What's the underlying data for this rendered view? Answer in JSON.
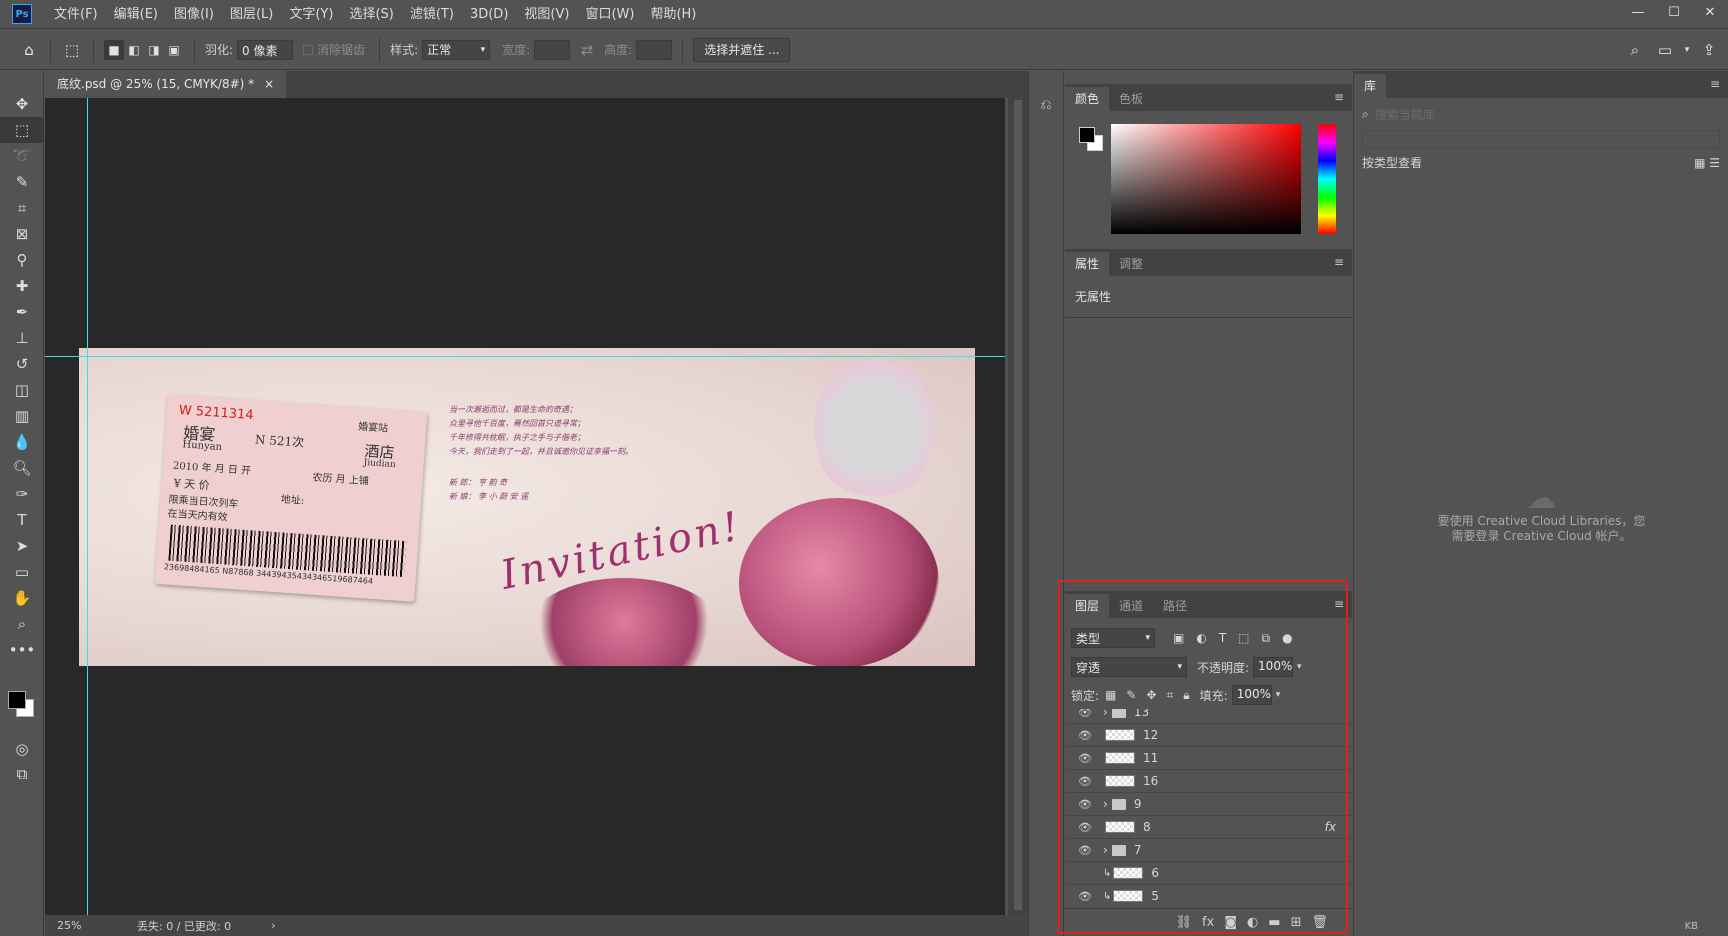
{
  "app": {
    "logo": "Ps"
  },
  "menu": [
    "文件(F)",
    "编辑(E)",
    "图像(I)",
    "图层(L)",
    "文字(Y)",
    "选择(S)",
    "滤镜(T)",
    "3D(D)",
    "视图(V)",
    "窗口(W)",
    "帮助(H)"
  ],
  "window_controls": {
    "minimize": "—",
    "maximize": "☐",
    "close": "✕"
  },
  "options": {
    "feather_label": "羽化:",
    "feather_value": "0 像素",
    "antialias_label": "消除锯齿",
    "style_label": "样式:",
    "style_value": "正常",
    "width_label": "宽度:",
    "height_label": "高度:",
    "select_mask_button": "选择并遮住 ..."
  },
  "document": {
    "tab_title": "底纹.psd @ 25% (15, CMYK/8#) *",
    "close": "×",
    "zoom": "25%",
    "status": "丢失: 0 / 已更改: 0",
    "status_arrow": "›"
  },
  "artwork": {
    "ticket_code": "W 5211314",
    "ticket_title": "婚宴",
    "ticket_pinyin": "Hunyan",
    "train": "N 521次",
    "station": "婚宴站",
    "hotel": "酒店",
    "hotel_pinyin": "Jiudian",
    "date_line": "2010 年  月  日  开",
    "lunar": "农历    月    上铺",
    "price": "¥ 天 价",
    "address": "地址:",
    "limit1": "限乘当日次列车",
    "limit2": "在当天内有效",
    "barcode_number": "23698484165 N87868 34439435434346519687464",
    "poem": [
      "当一次邂逅而过，都是生命的奇遇；",
      "众里寻他千百度，蓦然回首只道寻常；",
      "千年修得共枕眠，执子之手与子偕老；",
      "今天，我们走到了一起，并且诚邀你见证幸福一刻。"
    ],
    "groom": "新 郎：  亨 韵 奇",
    "bride": "新 娘：  李 小 蔚   安 遥",
    "invitation": "Invitation!"
  },
  "color_panel": {
    "tabs": [
      "颜色",
      "色板"
    ],
    "active": 0
  },
  "properties_panel": {
    "tabs": [
      "属性",
      "调整"
    ],
    "active": 0,
    "empty_text": "无属性"
  },
  "layers_panel": {
    "tabs": [
      "图层",
      "通道",
      "路径"
    ],
    "active": 0,
    "filter_value": "类型",
    "blend_mode": "穿透",
    "opacity_label": "不透明度:",
    "opacity_value": "100%",
    "lock_label": "锁定:",
    "fill_label": "填充:",
    "fill_value": "100%",
    "layers": [
      {
        "name": "13",
        "kind": "group",
        "visible": true
      },
      {
        "name": "12",
        "kind": "layer",
        "visible": true
      },
      {
        "name": "11",
        "kind": "layer",
        "visible": true
      },
      {
        "name": "16",
        "kind": "layer",
        "visible": true
      },
      {
        "name": "9",
        "kind": "group",
        "visible": true
      },
      {
        "name": "8",
        "kind": "layer",
        "visible": true,
        "fx": "fx"
      },
      {
        "name": "7",
        "kind": "group",
        "visible": true
      },
      {
        "name": "6",
        "kind": "clipped",
        "visible": false
      },
      {
        "name": "5",
        "kind": "clipped",
        "visible": true
      }
    ]
  },
  "library_panel": {
    "tab": "库",
    "search_placeholder": "搜索当前库",
    "view_label": "按类型查看",
    "message_line1": "要使用 Creative Cloud Libraries，您",
    "message_line2": "需要登录 Creative Cloud 帐户。",
    "footer_kb": "KB"
  },
  "colors": {
    "accent_highlight": "#e02020",
    "guide": "#3de0e0"
  }
}
